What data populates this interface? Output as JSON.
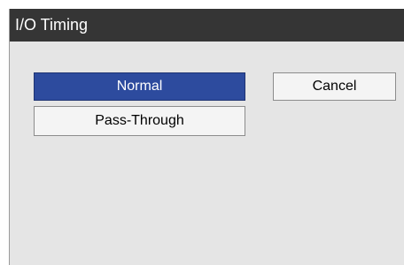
{
  "dialog": {
    "title": "I/O Timing"
  },
  "options": [
    {
      "label": "Normal",
      "selected": true
    },
    {
      "label": "Pass-Through",
      "selected": false
    }
  ],
  "cancel_label": "Cancel",
  "colors": {
    "title_bar": "#353535",
    "dialog_background": "#e5e5e5",
    "selected_button": "#2d4b9e",
    "button_background": "#f4f4f4"
  }
}
